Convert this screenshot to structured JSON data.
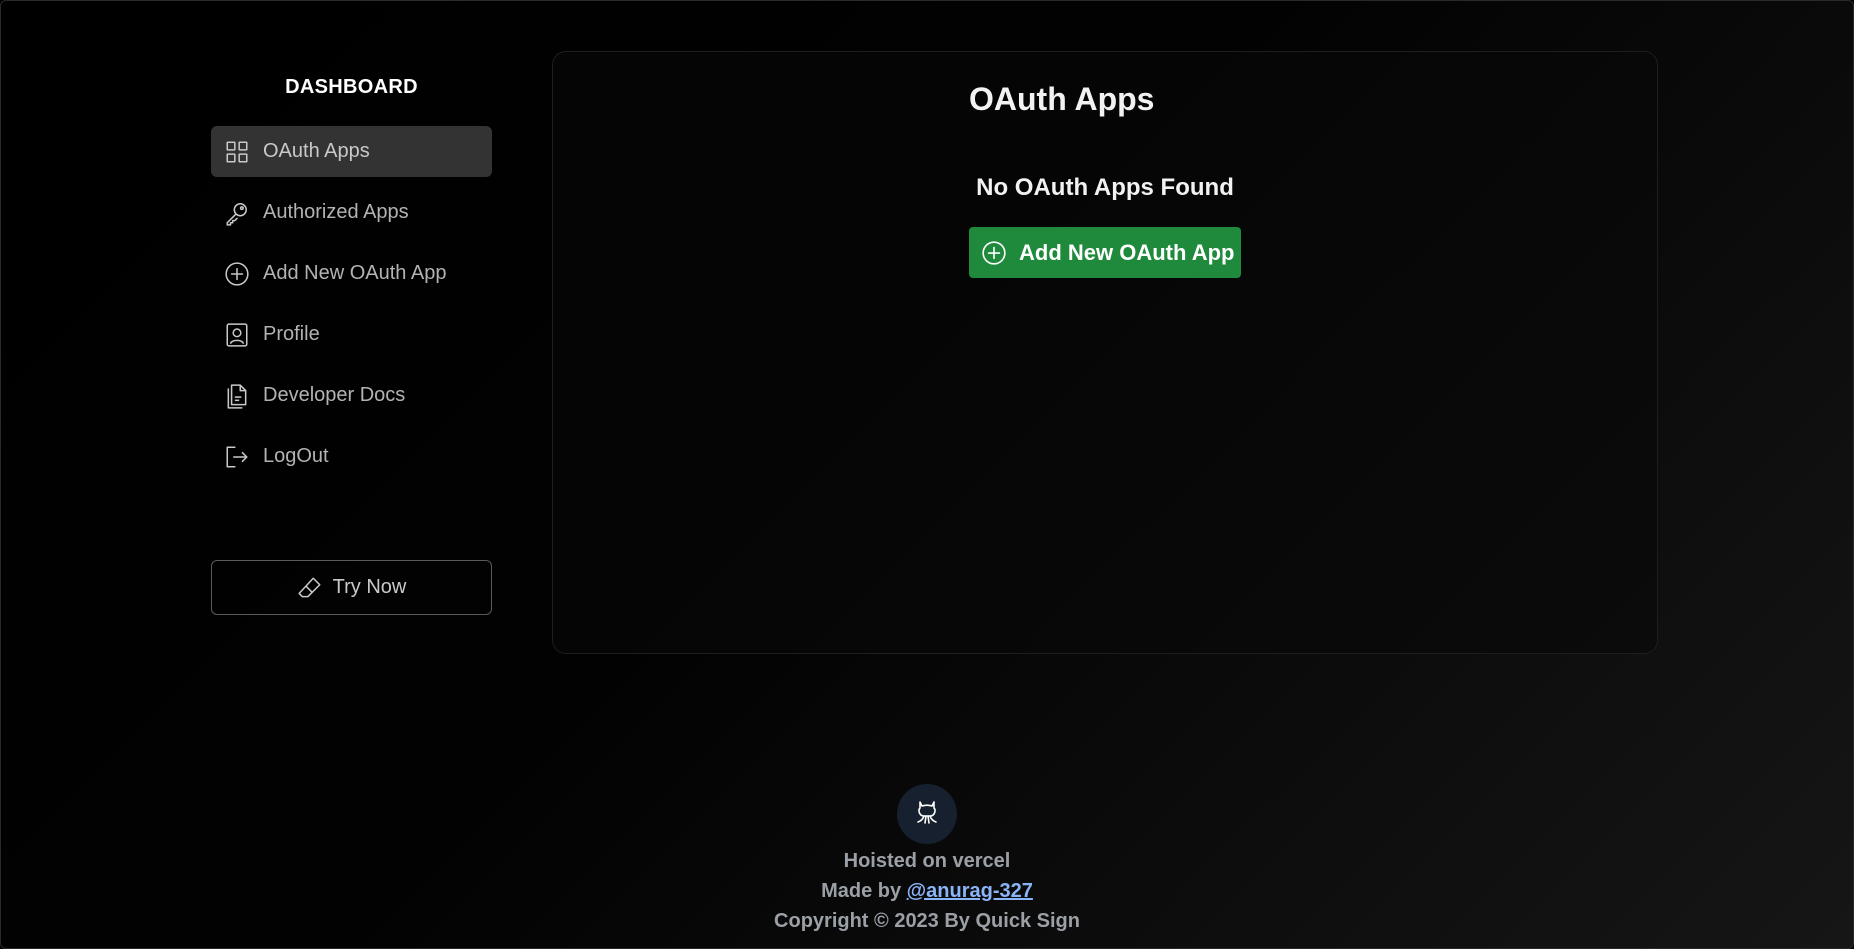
{
  "sidebar": {
    "title": "DASHBOARD",
    "items": [
      {
        "label": "OAuth Apps",
        "icon": "grid-icon",
        "active": true
      },
      {
        "label": "Authorized Apps",
        "icon": "key-icon",
        "active": false
      },
      {
        "label": "Add New OAuth App",
        "icon": "plus-circle-icon",
        "active": false
      },
      {
        "label": "Profile",
        "icon": "person-badge-icon",
        "active": false
      },
      {
        "label": "Developer Docs",
        "icon": "documents-icon",
        "active": false
      },
      {
        "label": "LogOut",
        "icon": "logout-icon",
        "active": false
      }
    ],
    "try_button": {
      "label": "Try Now",
      "icon": "eraser-icon"
    }
  },
  "main": {
    "title": "OAuth Apps",
    "empty_message": "No OAuth Apps Found",
    "add_button": {
      "label": "Add New OAuth App",
      "icon": "plus-circle-icon"
    }
  },
  "footer": {
    "icon": "github-icon",
    "hosted": "Hoisted on vercel",
    "made_by_prefix": "Made by ",
    "made_by_link": "@anurag-327",
    "copyright": "Copyright © 2023 By Quick Sign"
  },
  "colors": {
    "background": "#000000",
    "active_item": "#333333",
    "accent_green": "#1f8a3c",
    "link": "#8ab4f8",
    "muted_text": "#b3b3b3"
  }
}
